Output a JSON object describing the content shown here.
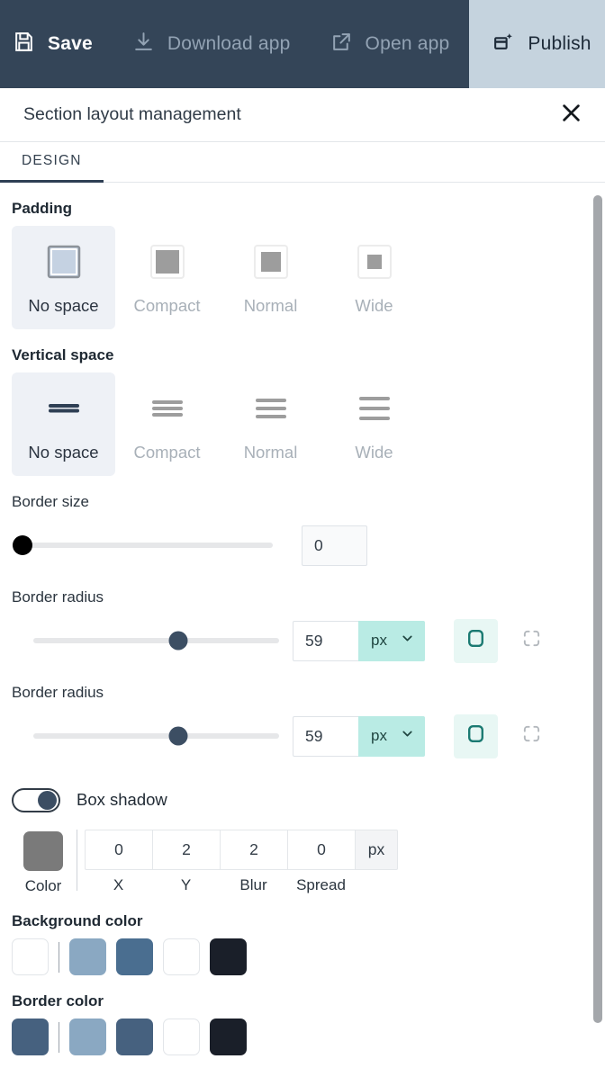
{
  "topbar": {
    "background": "#344558",
    "buttons": [
      {
        "label": "Save",
        "icon": "save-floppy-icon",
        "state": "active"
      },
      {
        "label": "Download app",
        "icon": "download-icon",
        "state": "dim"
      },
      {
        "label": "Open app",
        "icon": "external-link-icon",
        "state": "dim"
      },
      {
        "label": "Publish",
        "icon": "publish-sparkle-icon",
        "state": "highlighted"
      }
    ],
    "publish_background": "#c5d3de"
  },
  "panel": {
    "title": "Section layout management",
    "close_icon": "close-x-icon",
    "tabs": [
      {
        "label": "DESIGN",
        "active": true
      }
    ],
    "tab_underline_color": "#2e3f54"
  },
  "padding": {
    "label": "Padding",
    "options": [
      {
        "label": "No space",
        "icon": "padding-none-icon",
        "active": true
      },
      {
        "label": "Compact",
        "icon": "padding-compact-icon",
        "active": false
      },
      {
        "label": "Normal",
        "icon": "padding-normal-icon",
        "active": false
      },
      {
        "label": "Wide",
        "icon": "padding-wide-icon",
        "active": false
      }
    ]
  },
  "vertical_space": {
    "label": "Vertical space",
    "options": [
      {
        "label": "No space",
        "icon": "lines-tight-icon",
        "active": true
      },
      {
        "label": "Compact",
        "icon": "lines-compact-icon",
        "active": false
      },
      {
        "label": "Normal",
        "icon": "lines-normal-icon",
        "active": false
      },
      {
        "label": "Wide",
        "icon": "lines-wide-icon",
        "active": false
      }
    ]
  },
  "border_size": {
    "label": "Border size",
    "value": "0",
    "slider_percent": 0,
    "knob_color": "#000000"
  },
  "border_radius_1": {
    "label": "Border radius",
    "value": "59",
    "unit": "px",
    "slider_percent": 59,
    "knob_color": "#3c4e63",
    "corner_all_icon": "rounded-square-icon",
    "corner_individual_icon": "corner-segments-icon",
    "corner_all_active": true
  },
  "border_radius_2": {
    "label": "Border radius",
    "value": "59",
    "unit": "px",
    "slider_percent": 59,
    "knob_color": "#3c4e63",
    "corner_all_icon": "rounded-square-icon",
    "corner_individual_icon": "corner-segments-icon",
    "corner_all_active": true
  },
  "box_shadow": {
    "label": "Box shadow",
    "enabled": true,
    "color_label": "Color",
    "color_value": "#7a7a7a",
    "unit": "px",
    "fields": [
      {
        "caption": "X",
        "value": "0"
      },
      {
        "caption": "Y",
        "value": "2"
      },
      {
        "caption": "Blur",
        "value": "2"
      },
      {
        "caption": "Spread",
        "value": "0"
      }
    ]
  },
  "background_color": {
    "label": "Background color",
    "swatches": [
      "#ffffff",
      "#8aa8c2",
      "#4a6e90",
      "#ffffff",
      "#1a1f29"
    ],
    "divider_after_index": 0
  },
  "border_color": {
    "label": "Border color",
    "swatches": [
      "#46617f",
      "#8aa8c2",
      "#46617f",
      "#ffffff",
      "#1a1f29"
    ],
    "divider_after_index": 0
  }
}
